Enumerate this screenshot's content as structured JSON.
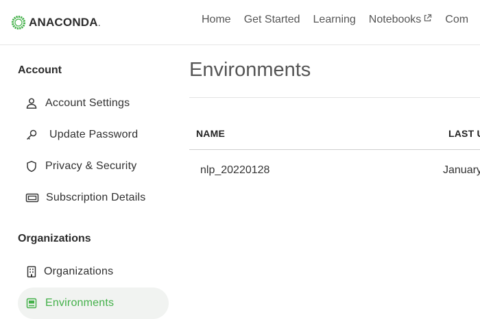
{
  "brand": {
    "name": "ANACONDA",
    "suffix": ".",
    "accent": "#43b049"
  },
  "nav": {
    "items": [
      {
        "label": "Home"
      },
      {
        "label": "Get Started"
      },
      {
        "label": "Learning"
      },
      {
        "label": "Notebooks",
        "icon": "external-link-icon"
      },
      {
        "label": "Com"
      }
    ]
  },
  "sidebar": {
    "account_title": "Account",
    "account_items": [
      {
        "label": "Account Settings",
        "icon": "user-icon"
      },
      {
        "label": "Update Password",
        "icon": "key-icon"
      },
      {
        "label": "Privacy & Security",
        "icon": "shield-icon"
      },
      {
        "label": "Subscription Details",
        "icon": "ticket-icon"
      }
    ],
    "org_title": "Organizations",
    "org_items": [
      {
        "label": "Organizations",
        "icon": "building-icon"
      },
      {
        "label": "Environments",
        "icon": "environment-icon",
        "active": true
      }
    ]
  },
  "main": {
    "title": "Environments",
    "columns": [
      "NAME",
      "LAST U"
    ],
    "rows": [
      {
        "name": "nlp_20220128",
        "last_updated": "January"
      }
    ]
  }
}
